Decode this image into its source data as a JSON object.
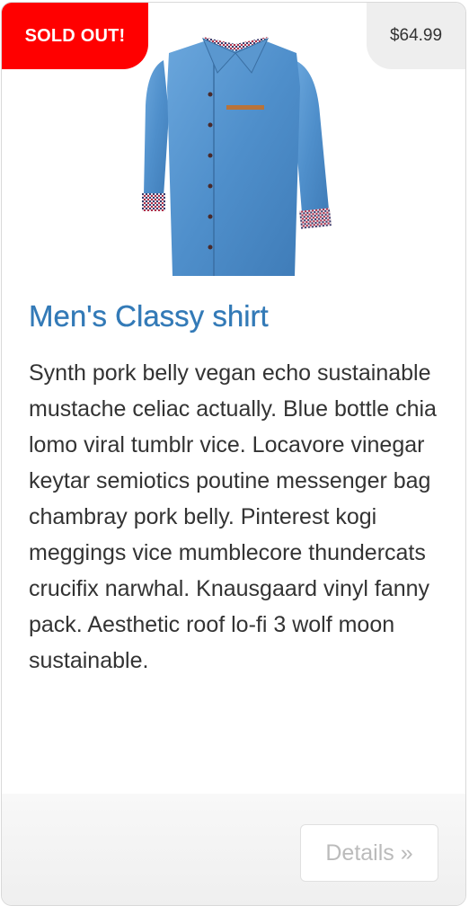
{
  "badge": {
    "sold_out_label": "SOLD OUT!",
    "price": "$64.99"
  },
  "product": {
    "title": "Men's Classy shirt",
    "description": "Synth pork belly vegan echo sustainable mustache celiac actually. Blue bottle chia lomo viral tumblr vice. Locavore vinegar keytar semiotics poutine messenger bag chambray pork belly. Pinterest kogi meggings vice mumblecore thundercats crucifix narwhal. Knausgaard vinyl fanny pack. Aesthetic roof lo-fi 3 wolf moon sustainable.",
    "image": "blue-denim-shirt"
  },
  "footer": {
    "details_label": "Details »"
  },
  "colors": {
    "sold_out_bg": "#ff0000",
    "title": "#337ab7",
    "price_bg": "#eeeeee",
    "shirt": "#5b9bd5"
  }
}
